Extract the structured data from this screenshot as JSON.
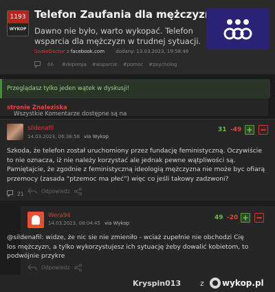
{
  "story": {
    "votes": "1193",
    "wykop_label": "WYKOP",
    "title": "Telefon Zaufania dla mężczyzn",
    "description": "Dawno nie było, warto wykopać. Telefon wsparcia dla mężczyzn w trudnej sytuacji.",
    "author": "SnakeDoctor",
    "source_sep": "z",
    "source": "facebook.com",
    "added": "dodany: 13.03.2023, 19:58:46",
    "comments": "66",
    "tags": [
      "#depresja",
      "#wsparcie",
      "#pomoc",
      "#psycholog"
    ],
    "thumbnail_colors": {
      "bg": "#2a2276",
      "rings": "#ffffff",
      "dots": "#ffffff"
    }
  },
  "notices": {
    "single_thread": "Przeglądasz tylko jeden wątek w dyskusji!",
    "all_comments_prefix": "Wszystkie Komentarze dostępne są na",
    "all_comments_link": "stronie Znaleziska",
    "all_comments_suffix": "."
  },
  "comment1": {
    "author": "sildenafil",
    "date": "14.03.2023, 06:38:58",
    "via": "via Wykop",
    "plus": "31",
    "minus": "-49",
    "text": "Szkoda, że telefon został uruchomiony przez fundację feministyczną. Oczywiście to nie oznacza, iż nie należy korzystać ale jednak pewne wątpliwości są. Pamiętajcie, że zgodnie z feministyczną ideologią mężczyzna nie może byc ofiarą przemocy (zasada \"ptzemoc ma płeć\") więc co jeśli takowy zadzwoni?",
    "reply_label": "Odpowiedz",
    "replies": "21"
  },
  "comment2": {
    "author": "Wera94",
    "date": "14.03.2023, 08:04:45",
    "via": "via Wykop",
    "plus": "49",
    "minus": "-20",
    "text": "@sildenafil: widze, że nic sie nie zmieniło - wciaż zupełnie nie obchodzi Cię los mężczyzn, a tylko wykorzystujesz ich sytuację żeby dowalić kobietom, to podwójnie przykre",
    "reply_label": "Odpowiedz"
  },
  "watermark": {
    "user": "Kryspin013",
    "z": "z",
    "brand": "wykop.pl"
  },
  "colors": {
    "accent_red": "#d2433b",
    "plus_green": "#6abd4b",
    "minus_red": "#e0463f",
    "notice_green": "#9fd08a"
  }
}
